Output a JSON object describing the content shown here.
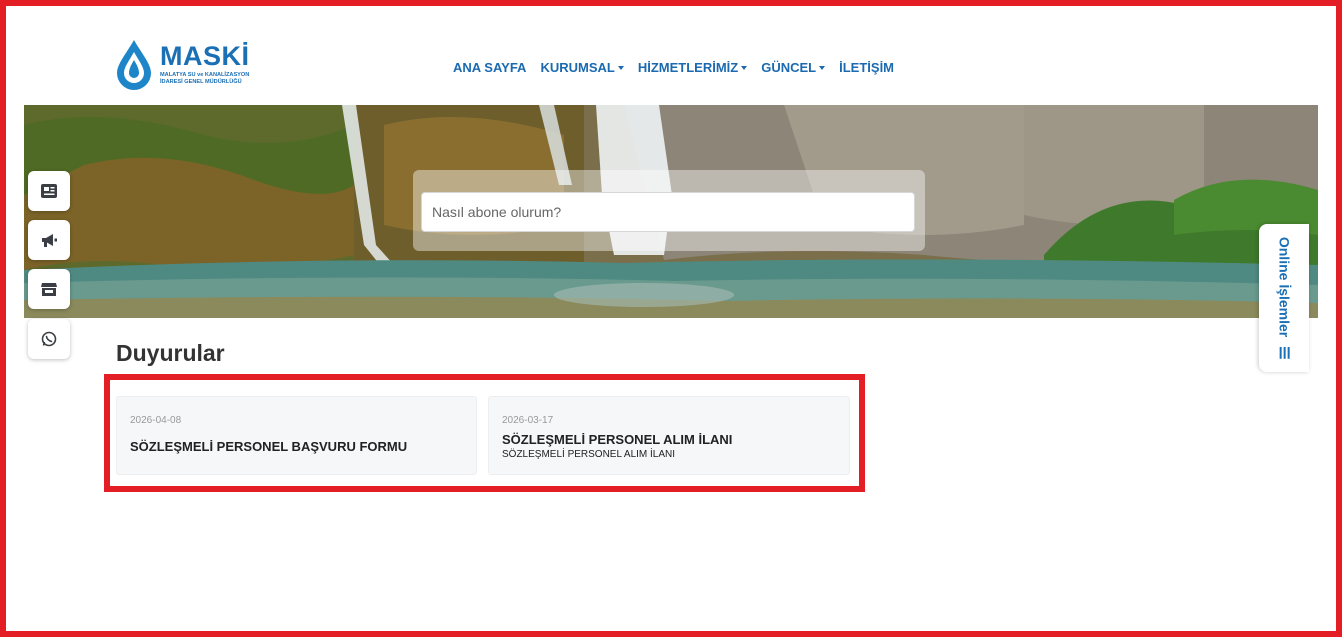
{
  "header": {
    "logo": {
      "title": "MASKİ",
      "subtitle_line1": "MALATYA SU ve KANALİZASYON",
      "subtitle_line2": "İDARESİ GENEL MÜDÜRLÜĞÜ"
    },
    "nav": [
      {
        "label": "ANA SAYFA",
        "dropdown": false
      },
      {
        "label": "KURUMSAL",
        "dropdown": true
      },
      {
        "label": "HİZMETLERİMİZ",
        "dropdown": true
      },
      {
        "label": "GÜNCEL",
        "dropdown": true
      },
      {
        "label": "İLETİŞİM",
        "dropdown": false
      }
    ]
  },
  "hero": {
    "search": {
      "placeholder": "Nasıl abone olurum?",
      "value": ""
    }
  },
  "side_quick_buttons": [
    {
      "icon": "newspaper-icon"
    },
    {
      "icon": "megaphone-icon"
    },
    {
      "icon": "store-icon"
    },
    {
      "icon": "whatsapp-icon"
    }
  ],
  "online_tab": {
    "label": "Online İşlemler",
    "icon": "menu-bars-icon"
  },
  "announcements": {
    "title": "Duyurular",
    "items": [
      {
        "date": "2026-04-08",
        "title": "SÖZLEŞMELİ PERSONEL BAŞVURU FORMU",
        "subtitle": ""
      },
      {
        "date": "2026-03-17",
        "title": "SÖZLEŞMELİ PERSONEL ALIM İLANI",
        "subtitle": "SÖZLEŞMELİ PERSONEL ALIM İLANI"
      }
    ]
  },
  "colors": {
    "brand_blue": "#1a6fb5",
    "highlight_red": "#e31e24"
  }
}
